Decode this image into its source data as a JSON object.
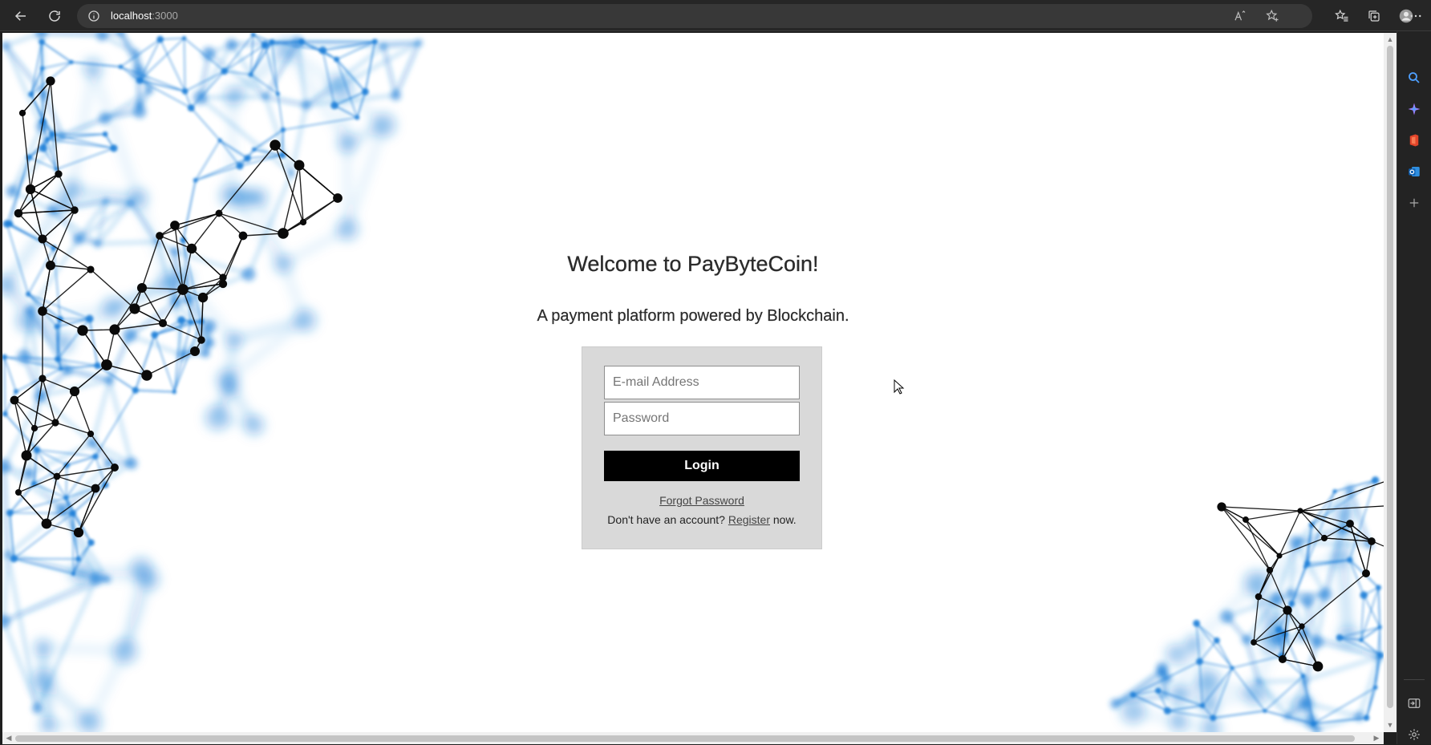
{
  "browser": {
    "url_host": "localhost",
    "url_port": ":3000",
    "icons": {
      "back": "arrow-left-icon",
      "refresh": "refresh-icon",
      "info": "info-icon",
      "read_aloud": "read-aloud-icon",
      "add_favorite": "star-plus-icon",
      "favorites": "favorites-icon",
      "collections": "collections-icon",
      "profile": "profile-icon",
      "more": "more-icon"
    }
  },
  "sidebar": {
    "items": [
      "search-icon",
      "copilot-icon",
      "office-icon",
      "outlook-icon",
      "add-icon"
    ],
    "bottom": [
      "split-screen-icon",
      "settings-icon"
    ]
  },
  "page": {
    "welcome": "Welcome to PayByteCoin!",
    "tagline": "A payment platform powered by Blockchain.",
    "email_placeholder": "E-mail Address",
    "password_placeholder": "Password",
    "login_label": "Login",
    "forgot_label": "Forgot Password",
    "register_prefix": "Don't have an account? ",
    "register_link": "Register",
    "register_suffix": " now."
  },
  "colors": {
    "accent_blue": "#1e7fd8",
    "node_black": "#0a0a0a",
    "button": "#000000",
    "panel": "#d9d9d9"
  }
}
